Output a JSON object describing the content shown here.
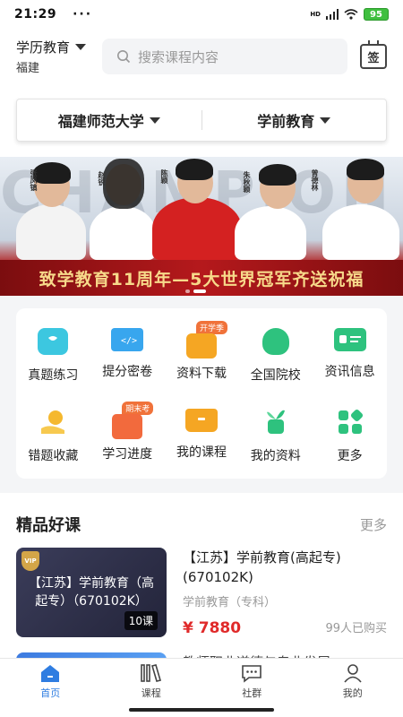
{
  "status_bar": {
    "time": "21:29",
    "dots": "···",
    "net": "HD",
    "battery": "95"
  },
  "header": {
    "edu_label": "学历教育",
    "region": "福建",
    "search_placeholder": "搜索课程内容",
    "checkin_label": "签"
  },
  "selector": {
    "school": "福建师范大学",
    "major": "学前教育"
  },
  "banner": {
    "text": "致学教育11周年—5大世界冠军齐送祝福",
    "bg_letters": "CHAMPION",
    "athletes": [
      {
        "name": "张凤镇",
        "title": "首届健美操冠军"
      },
      {
        "name": "赵锐",
        "title": "浙江省运动员"
      },
      {
        "name": "陈颖",
        "title": "奥运冠军"
      },
      {
        "name": "朱秋颖",
        "title": "花样滑冰冠军"
      },
      {
        "name": "曾德林",
        "title": "跳水冠军"
      }
    ],
    "slide_count": 2,
    "active_slide": 2
  },
  "menu": {
    "items": [
      {
        "label": "真题练习",
        "icon": "message-icon",
        "color": "#3cc7e0"
      },
      {
        "label": "提分密卷",
        "icon": "monitor-icon",
        "color": "#38a6ee"
      },
      {
        "label": "资料下载",
        "icon": "bag-icon",
        "color": "#f5a623",
        "tag": "开学季"
      },
      {
        "label": "全国院校",
        "icon": "head-icon",
        "color": "#2ec27e"
      },
      {
        "label": "资讯信息",
        "icon": "id-card-icon",
        "color": "#2ec27e"
      },
      {
        "label": "错题收藏",
        "icon": "coin-hand-icon",
        "color": "#f5b82e"
      },
      {
        "label": "学习进度",
        "icon": "progress-book-icon",
        "color": "#f26a3d",
        "tag": "期末考"
      },
      {
        "label": "我的课程",
        "icon": "folder-icon",
        "color": "#f5a623"
      },
      {
        "label": "我的资料",
        "icon": "plant-icon",
        "color": "#2ec27e"
      },
      {
        "label": "更多",
        "icon": "grid-icon",
        "color": "#2ec27e"
      }
    ]
  },
  "featured": {
    "title": "精品好课",
    "more": "更多",
    "courses": [
      {
        "thumb_text": "【江苏】学前教育（高起专）（670102K）",
        "badge": "VIP",
        "lessons": "10课",
        "title": "【江苏】学前教育(高起专)(670102K)",
        "category": "学前教育（专科）",
        "price": "¥ 7880",
        "buyers": "99人已购买"
      },
      {
        "title": "教师职业道德与专业发展"
      }
    ]
  },
  "tabbar": {
    "tabs": [
      {
        "label": "首页",
        "icon": "home-icon",
        "active": true
      },
      {
        "label": "课程",
        "icon": "books-icon",
        "active": false
      },
      {
        "label": "社群",
        "icon": "chat-bubble-icon",
        "active": false
      },
      {
        "label": "我的",
        "icon": "person-icon",
        "active": false
      }
    ]
  },
  "colors": {
    "accent": "#2f7de1",
    "price": "#e02a2a",
    "banner_red": "#b5191c"
  }
}
